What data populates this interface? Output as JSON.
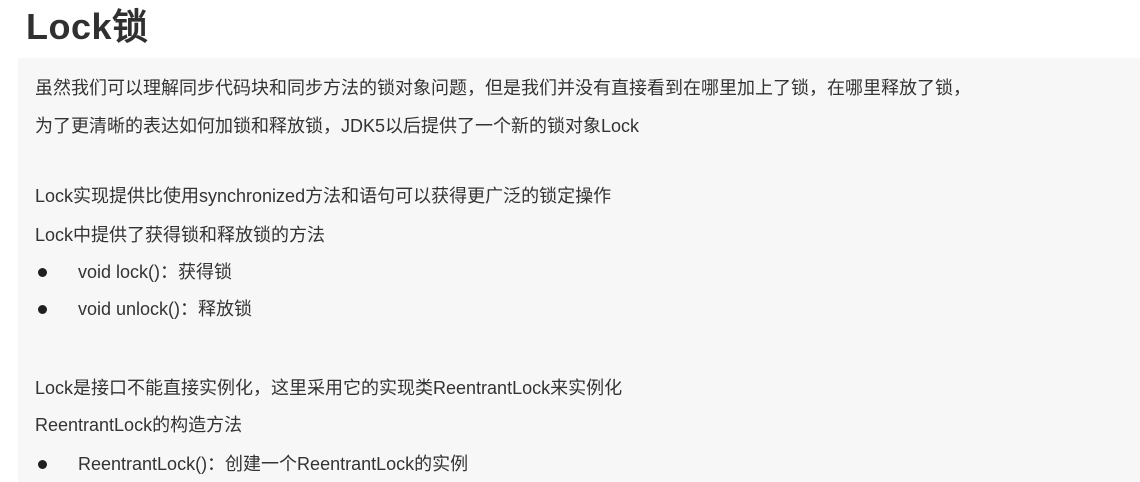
{
  "title": "Lock锁",
  "intro": {
    "line1": "虽然我们可以理解同步代码块和同步方法的锁对象问题，但是我们并没有直接看到在哪里加上了锁，在哪里释放了锁，",
    "line2": "为了更清晰的表达如何加锁和释放锁，JDK5以后提供了一个新的锁对象Lock"
  },
  "section1": {
    "line1": "Lock实现提供比使用synchronized方法和语句可以获得更广泛的锁定操作",
    "line2": "Lock中提供了获得锁和释放锁的方法",
    "bullets": [
      "void lock()：获得锁",
      "void unlock()：释放锁"
    ]
  },
  "section2": {
    "line1": "Lock是接口不能直接实例化，这里采用它的实现类ReentrantLock来实例化",
    "line2": "ReentrantLock的构造方法",
    "bullets": [
      "ReentrantLock()：创建一个ReentrantLock的实例"
    ]
  }
}
